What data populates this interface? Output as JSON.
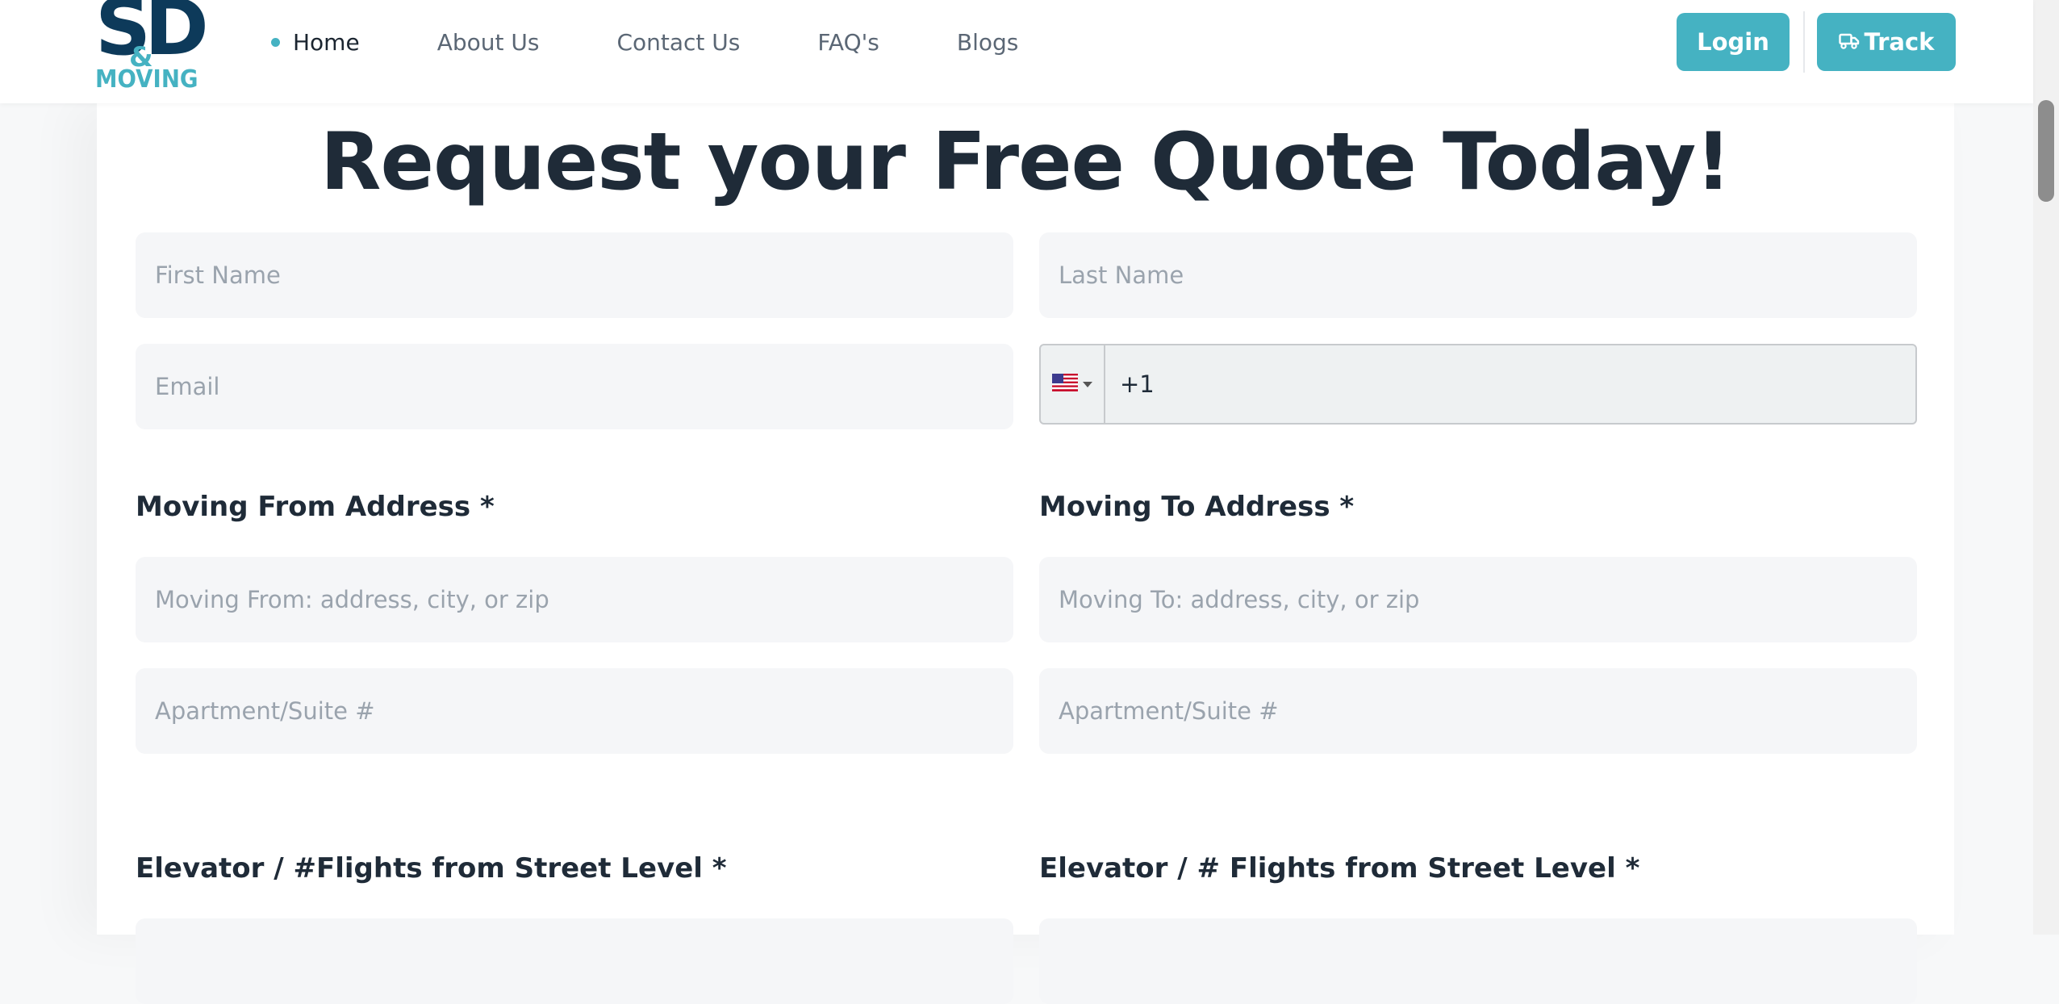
{
  "brand": {
    "logo_main": "SD",
    "logo_amp": "&",
    "logo_sub": "MOVING",
    "primary_color": "#45b2c2",
    "dark_color": "#0d3a5a"
  },
  "nav": {
    "items": [
      {
        "label": "Home",
        "active": true
      },
      {
        "label": "About Us"
      },
      {
        "label": "Contact Us"
      },
      {
        "label": "FAQ's"
      },
      {
        "label": "Blogs"
      }
    ],
    "login_label": "Login",
    "track_label": "Track"
  },
  "form": {
    "title": "Request your Free Quote Today!",
    "first_name_placeholder": "First Name",
    "last_name_placeholder": "Last Name",
    "email_placeholder": "Email",
    "phone_value": "+1",
    "phone_country_icon": "us-flag-icon",
    "moving_from_label": "Moving From Address *",
    "moving_to_label": "Moving To Address *",
    "moving_from_placeholder": "Moving From: address, city, or zip",
    "moving_to_placeholder": "Moving To: address, city, or zip",
    "apt_from_placeholder": "Apartment/Suite #",
    "apt_to_placeholder": "Apartment/Suite #",
    "elevator_from_label": "Elevator / #Flights from Street Level *",
    "elevator_to_label": "Elevator / # Flights from Street Level *"
  }
}
